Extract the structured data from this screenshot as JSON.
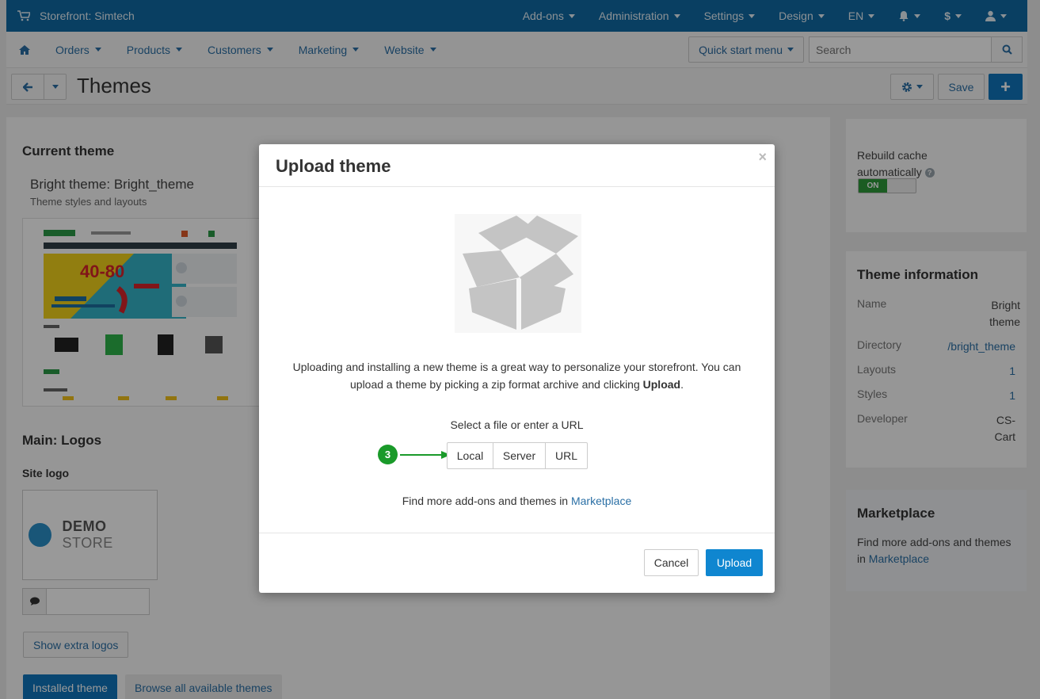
{
  "topbar": {
    "brand": "Storefront: Simtech",
    "menus": [
      "Add-ons",
      "Administration",
      "Settings",
      "Design",
      "EN"
    ]
  },
  "nav": {
    "items": [
      "Orders",
      "Products",
      "Customers",
      "Marketing",
      "Website"
    ],
    "quick_start": "Quick start menu",
    "search_placeholder": "Search"
  },
  "titlebar": {
    "title": "Themes",
    "save": "Save"
  },
  "main": {
    "current_theme_heading": "Current theme",
    "theme_name": "Bright theme: Bright_theme",
    "theme_desc": "Theme styles and layouts",
    "logos_heading": "Main: Logos",
    "site_logo_label": "Site logo",
    "logo_text_bold": "DEMO",
    "logo_text_light": " STORE",
    "show_extra_logos": "Show extra logos",
    "tab_installed": "Installed theme",
    "tab_browse": "Browse all available themes"
  },
  "sidebar": {
    "rebuild_cache": "Rebuild cache automatically",
    "toggle_on": "ON",
    "theme_info_heading": "Theme information",
    "info": [
      {
        "label": "Name",
        "value": "Bright theme"
      },
      {
        "label": "Directory",
        "value": "/bright_theme"
      },
      {
        "label": "Layouts",
        "value": "1"
      },
      {
        "label": "Styles",
        "value": "1"
      },
      {
        "label": "Developer",
        "value": "CS-Cart"
      }
    ],
    "marketplace_heading": "Marketplace",
    "marketplace_text": "Find more add-ons and themes in ",
    "marketplace_link": "Marketplace"
  },
  "modal": {
    "title": "Upload theme",
    "close": "×",
    "description_1": "Uploading and installing a new theme is a great way to personalize your storefront. You can upload a theme by picking a zip format archive and clicking ",
    "description_bold": "Upload",
    "description_end": ".",
    "select_label": "Select a file or enter a URL",
    "options": [
      "Local",
      "Server",
      "URL"
    ],
    "step_number": "3",
    "find_text": "Find more add-ons and themes in ",
    "find_link": "Marketplace",
    "cancel": "Cancel",
    "upload": "Upload"
  },
  "colors": {
    "topbar": "#0f6aa3",
    "primary": "#0f75bc",
    "link": "#2a6fa5",
    "step_green": "#1a9a2a",
    "toggle_on": "#2e9a3a"
  }
}
